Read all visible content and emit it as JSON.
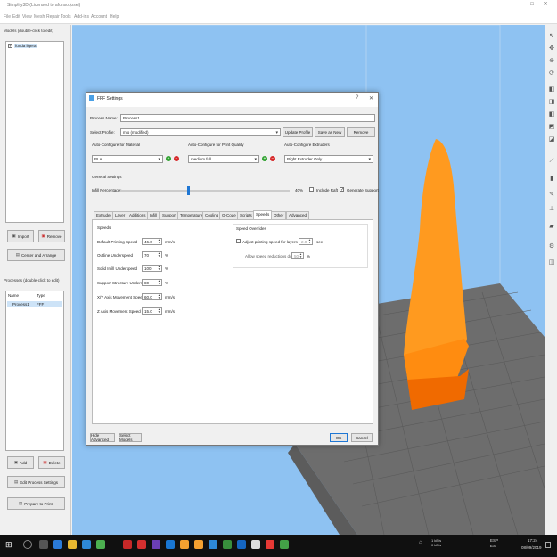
{
  "window": {
    "title": "Simplify3D (Licensed to afonso.josei)",
    "minimize": "—",
    "maximize": "□",
    "close": "✕"
  },
  "menu": [
    "File",
    "Edit",
    "View",
    "Mesh",
    "Repair",
    "Tools",
    "Add-ins",
    "Account",
    "Help"
  ],
  "models_panel": {
    "label": "Models (double-click to edit)",
    "items": [
      {
        "name": "funda ligera",
        "checked": true
      }
    ],
    "import_label": "Import",
    "remove_label": "Remove",
    "center_label": "Center and Arrange"
  },
  "processes_panel": {
    "label": "Processes (double-click to edit)",
    "columns": [
      "Name",
      "Type"
    ],
    "rows": [
      {
        "name": "Process1",
        "type": "FFF"
      }
    ],
    "add_label": "Add",
    "delete_label": "Delete",
    "edit_label": "Edit Process Settings",
    "prepare_label": "Prepare to Print!"
  },
  "dialog": {
    "title": "FFF Settings",
    "help": "?",
    "close": "✕",
    "process_name_label": "Process Name:",
    "process_name": "Process1",
    "select_profile_label": "Select Profile:",
    "profile": "mio (modified)",
    "update_profile": "Update Profile",
    "save_as_new": "Save as New",
    "remove": "Remove",
    "material_label": "Auto-Configure for Material",
    "material": "PLA",
    "quality_label": "Auto-Configure for Print Quality",
    "quality": "medium full",
    "extruders_label": "Auto-Configure Extruders",
    "extruders": "Right Extruder Only",
    "general_label": "General Settings",
    "infill_label": "Infill Percentage:",
    "infill_value": "40%",
    "infill_fraction": 0.4,
    "include_raft": "Include Raft",
    "include_raft_checked": false,
    "generate_support": "Generate Support",
    "generate_support_checked": true,
    "tabs": [
      "Extruder",
      "Layer",
      "Additions",
      "Infill",
      "Support",
      "Temperature",
      "Cooling",
      "G-Code",
      "Scripts",
      "Speeds",
      "Other",
      "Advanced"
    ],
    "active_tab": "Speeds",
    "speeds": {
      "group_label": "Speeds",
      "rows": [
        {
          "label": "Default Printing Speed",
          "value": "46.0",
          "unit": "mm/s"
        },
        {
          "label": "Outline Underspeed",
          "value": "70",
          "unit": "%"
        },
        {
          "label": "Solid Infill Underspeed",
          "value": "100",
          "unit": "%"
        },
        {
          "label": "Support Structure Underspeed",
          "value": "80",
          "unit": "%"
        },
        {
          "label": "X/Y Axis Movement Speed",
          "value": "60.0",
          "unit": "mm/s"
        },
        {
          "label": "Z Axis Movement Speed",
          "value": "15.0",
          "unit": "mm/s"
        }
      ]
    },
    "overrides": {
      "group_label": "Speed Overrides",
      "adjust_label": "Adjust printing speed for layers below",
      "adjust_checked": false,
      "adjust_value": "2.0",
      "adjust_unit": "sec",
      "allow_label": "Allow speed reductions down to",
      "allow_value": "50",
      "allow_unit": "%"
    },
    "hide_advanced": "Hide Advanced",
    "select_models": "Select Models",
    "ok": "OK",
    "cancel": "Cancel"
  },
  "taskbar": {
    "network": "1 kB/s\n0 kB/s",
    "lang": "ESP\nES",
    "time": "17:24",
    "date": "08/09/2019"
  },
  "colors": {
    "viewport_bg": "#8ec2f2",
    "model_orange": "#ff9a1f",
    "model_dark": "#f06a00",
    "plate": "#6d6d6d"
  }
}
